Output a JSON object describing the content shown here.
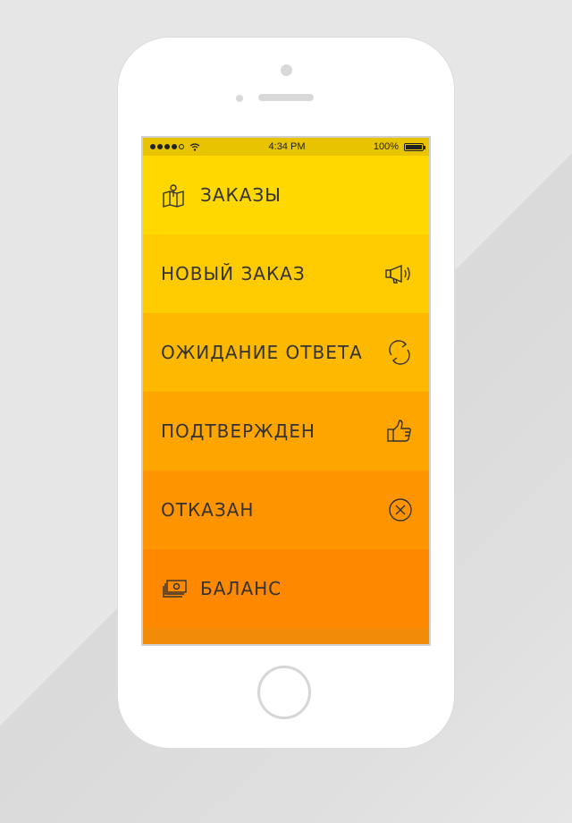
{
  "status_bar": {
    "signal_dots": 5,
    "time": "4:34 PM",
    "battery": "100%"
  },
  "menu": {
    "items": [
      {
        "label": "ЗАКАЗЫ",
        "icon": "map-pin-icon",
        "color": "#ffd800"
      },
      {
        "label": "НОВЫЙ ЗАКАЗ",
        "icon": "megaphone-icon",
        "color": "#fdcb00"
      },
      {
        "label": "ОЖИДАНИЕ ОТВЕТА",
        "icon": "refresh-icon",
        "color": "#fdb800"
      },
      {
        "label": "ПОДТВЕРЖДЕН",
        "icon": "thumbs-up-icon",
        "color": "#fea500"
      },
      {
        "label": "ОТКАЗАН",
        "icon": "close-circle-icon",
        "color": "#fe9500"
      },
      {
        "label": "БАЛАНС",
        "icon": "money-icon",
        "color": "#fe8800"
      }
    ]
  },
  "colors": {
    "background": "#e6e6e6",
    "status_bar": "#e8c300",
    "bottom_strip": "#f28b08"
  }
}
